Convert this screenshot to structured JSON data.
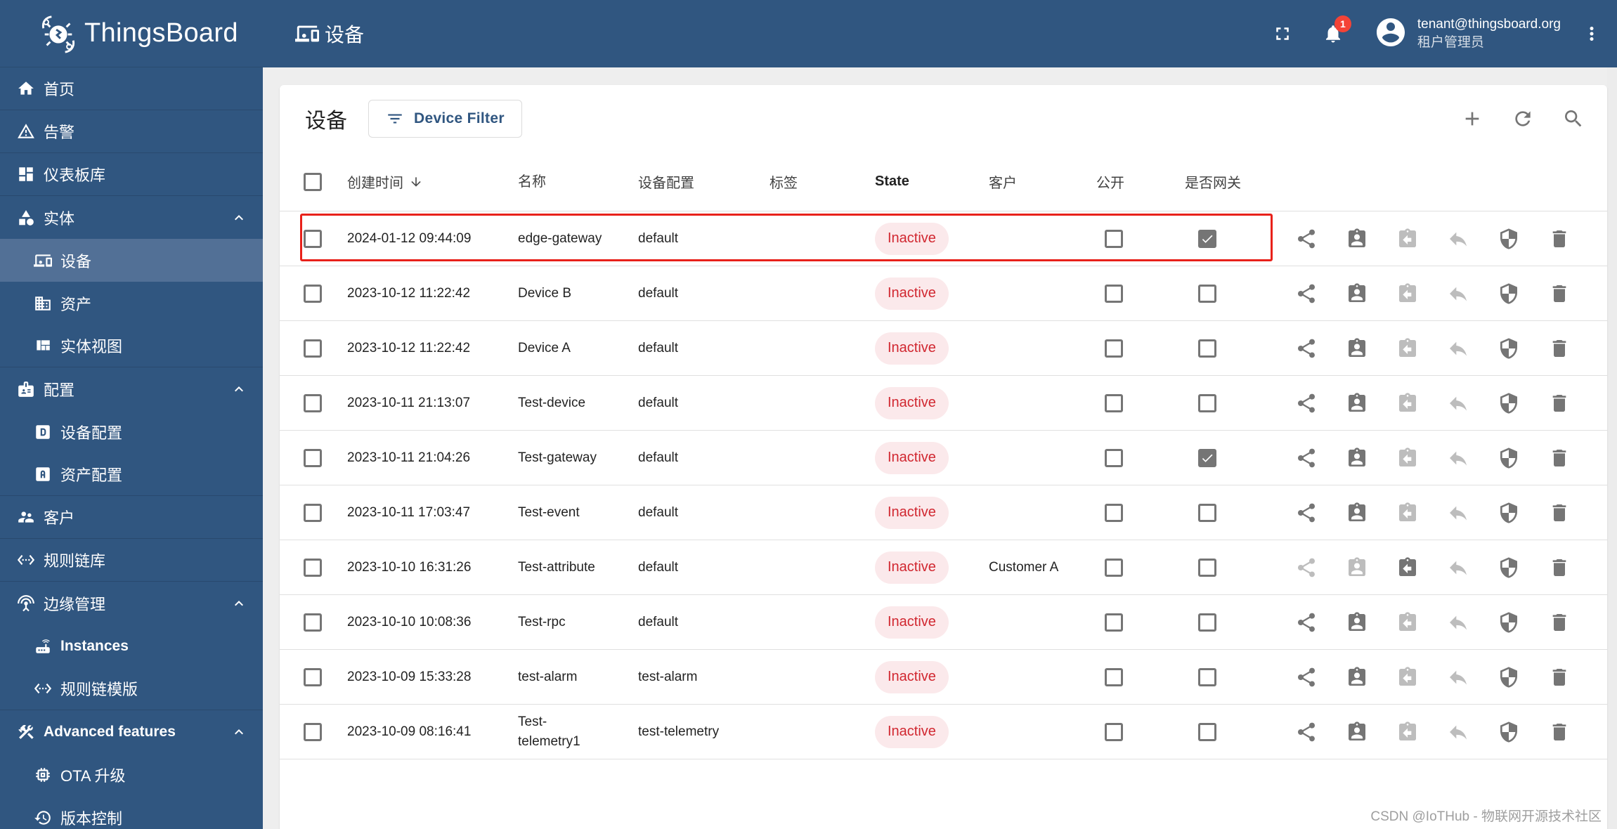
{
  "app": {
    "brand": "ThingsBoard",
    "page_title": "设备"
  },
  "sidebar": {
    "items": [
      {
        "label": "首页",
        "icon": "home-icon"
      },
      {
        "label": "告警",
        "icon": "warning-icon"
      },
      {
        "label": "仪表板库",
        "icon": "dashboard-icon"
      },
      {
        "label": "实体",
        "icon": "category-icon",
        "expanded": true
      },
      {
        "label": "设备",
        "icon": "devices-icon",
        "selected": true
      },
      {
        "label": "资产",
        "icon": "domain-icon"
      },
      {
        "label": "实体视图",
        "icon": "view-quilt-icon"
      },
      {
        "label": "配置",
        "icon": "badge-icon",
        "expanded": true
      },
      {
        "label": "设备配置",
        "icon": "device-profile-icon"
      },
      {
        "label": "资产配置",
        "icon": "asset-profile-icon"
      },
      {
        "label": "客户",
        "icon": "supervisor-account-icon"
      },
      {
        "label": "规则链库",
        "icon": "settings-ethernet-icon"
      },
      {
        "label": "边缘管理",
        "icon": "settings-input-antenna-icon",
        "expanded": true
      },
      {
        "label": "Instances",
        "icon": "router-icon"
      },
      {
        "label": "规则链模版",
        "icon": "settings-ethernet-icon"
      },
      {
        "label": "Advanced features",
        "icon": "construction-icon",
        "expanded": true
      },
      {
        "label": "OTA 升级",
        "icon": "memory-icon"
      },
      {
        "label": "版本控制",
        "icon": "history-icon"
      }
    ]
  },
  "topbar": {
    "notification_count": "1",
    "user_email": "tenant@thingsboard.org",
    "user_role": "租户管理员"
  },
  "card": {
    "title": "设备",
    "filter_label": "Device Filter"
  },
  "table": {
    "columns": {
      "created": "创建时间",
      "name": "名称",
      "profile": "设备配置",
      "label": "标签",
      "state": "State",
      "customer": "客户",
      "public": "公开",
      "gateway": "是否网关"
    },
    "rows": [
      {
        "created": "2024-01-12 09:44:09",
        "name": "edge-gateway",
        "profile": "default",
        "label": "",
        "state": "Inactive",
        "customer": "",
        "public": false,
        "gateway": true,
        "assigned": false,
        "highlighted": true
      },
      {
        "created": "2023-10-12 11:22:42",
        "name": "Device B",
        "profile": "default",
        "label": "",
        "state": "Inactive",
        "customer": "",
        "public": false,
        "gateway": false,
        "assigned": false
      },
      {
        "created": "2023-10-12 11:22:42",
        "name": "Device A",
        "profile": "default",
        "label": "",
        "state": "Inactive",
        "customer": "",
        "public": false,
        "gateway": false,
        "assigned": false
      },
      {
        "created": "2023-10-11 21:13:07",
        "name": "Test-device",
        "profile": "default",
        "label": "",
        "state": "Inactive",
        "customer": "",
        "public": false,
        "gateway": false,
        "assigned": false
      },
      {
        "created": "2023-10-11 21:04:26",
        "name": "Test-gateway",
        "profile": "default",
        "label": "",
        "state": "Inactive",
        "customer": "",
        "public": false,
        "gateway": true,
        "assigned": false
      },
      {
        "created": "2023-10-11 17:03:47",
        "name": "Test-event",
        "profile": "default",
        "label": "",
        "state": "Inactive",
        "customer": "",
        "public": false,
        "gateway": false,
        "assigned": false
      },
      {
        "created": "2023-10-10 16:31:26",
        "name": "Test-attribute",
        "profile": "default",
        "label": "",
        "state": "Inactive",
        "customer": "Customer A",
        "public": false,
        "gateway": false,
        "assigned": true
      },
      {
        "created": "2023-10-10 10:08:36",
        "name": "Test-rpc",
        "profile": "default",
        "label": "",
        "state": "Inactive",
        "customer": "",
        "public": false,
        "gateway": false,
        "assigned": false
      },
      {
        "created": "2023-10-09 15:33:28",
        "name": "test-alarm",
        "profile": "test-alarm",
        "label": "",
        "state": "Inactive",
        "customer": "",
        "public": false,
        "gateway": false,
        "assigned": false
      },
      {
        "created": "2023-10-09 08:16:41",
        "name": "Test-telemetry1",
        "profile": "test-telemetry",
        "label": "",
        "state": "Inactive",
        "customer": "",
        "public": false,
        "gateway": false,
        "assigned": false
      }
    ],
    "row_actions": [
      "share-icon",
      "assign-to-customer-icon",
      "unassign-from-customer-icon",
      "unassign-from-edge-icon",
      "manage-credentials-icon",
      "delete-icon"
    ]
  },
  "colors": {
    "primary": "#305680",
    "sidebar_selected": "#527096",
    "inactive_text": "#d12730",
    "inactive_bg": "#fbe9eb",
    "highlight_box": "#e8211a",
    "badge": "#f44336"
  },
  "watermark": "CSDN @IoTHub - 物联网开源技术社区"
}
